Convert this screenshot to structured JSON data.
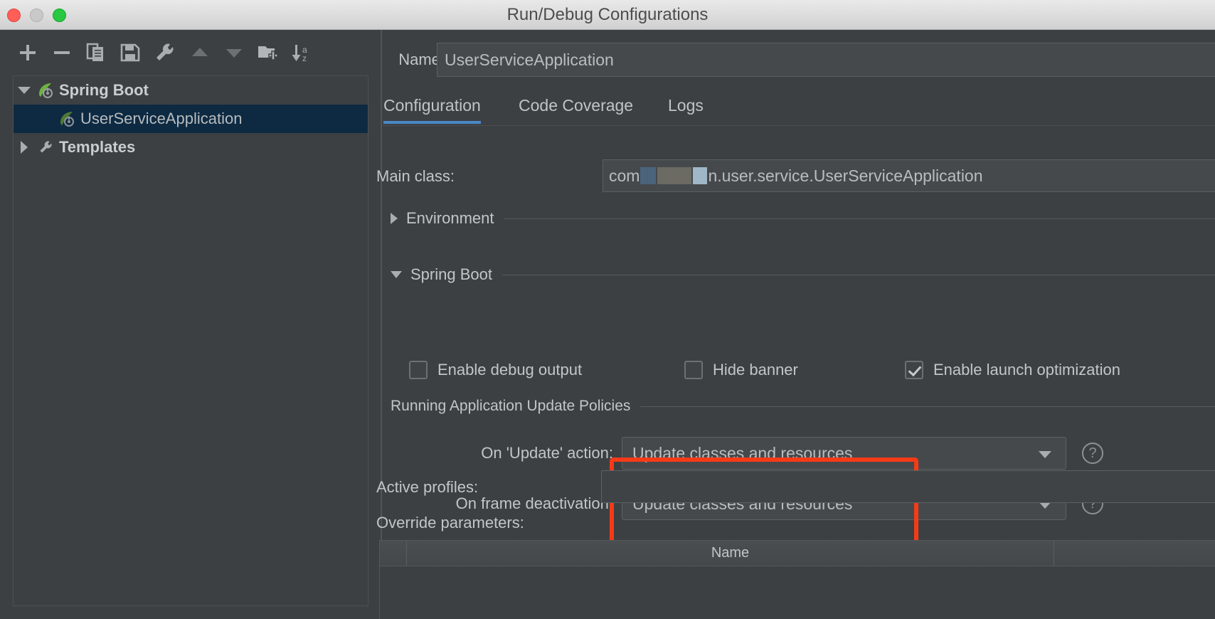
{
  "window": {
    "title": "Run/Debug Configurations",
    "traffic_lights": [
      "close",
      "minimize",
      "maximize"
    ]
  },
  "toolbar": {
    "buttons": [
      {
        "name": "add-button",
        "icon": "plus-icon",
        "label": "Add New Configuration"
      },
      {
        "name": "remove-button",
        "icon": "minus-icon",
        "label": "Remove Configuration"
      },
      {
        "name": "copy-button",
        "icon": "copy-icon",
        "label": "Copy Configuration"
      },
      {
        "name": "save-button",
        "icon": "save-icon",
        "label": "Save Configuration"
      },
      {
        "name": "edit-templates-button",
        "icon": "wrench-icon",
        "label": "Edit Templates"
      },
      {
        "name": "move-up-button",
        "icon": "triangle-up-icon",
        "label": "Move Up"
      },
      {
        "name": "move-down-button",
        "icon": "triangle-down-icon",
        "label": "Move Down"
      },
      {
        "name": "new-folder-button",
        "icon": "folder-add-icon",
        "label": "Create New Folder"
      },
      {
        "name": "sort-button",
        "icon": "sort-az-icon",
        "label": "Sort Configurations"
      }
    ]
  },
  "tree": {
    "nodes": [
      {
        "label": "Spring Boot",
        "level": 0,
        "expanded": true,
        "icon": "spring-boot-icon",
        "selected": false,
        "bold": true
      },
      {
        "label": "UserServiceApplication",
        "level": 1,
        "expanded": null,
        "icon": "spring-boot-icon",
        "selected": true,
        "bold": false
      },
      {
        "label": "Templates",
        "level": 0,
        "expanded": false,
        "icon": "wrench-icon",
        "selected": false,
        "bold": true
      }
    ]
  },
  "form": {
    "name_label": "Name:",
    "name_value": "UserServiceApplication",
    "main_class_label": "Main class:",
    "main_class_prefix": "com",
    "main_class_suffix": "n.user.service.UserServiceApplication",
    "active_profiles_label": "Active profiles:",
    "active_profiles_value": "",
    "override_parameters_label": "Override parameters:"
  },
  "tabs": [
    {
      "label": "Configuration",
      "active": true
    },
    {
      "label": "Code Coverage",
      "active": false
    },
    {
      "label": "Logs",
      "active": false
    }
  ],
  "sections": [
    {
      "title": "Environment",
      "expanded": false
    },
    {
      "title": "Spring Boot",
      "expanded": true
    }
  ],
  "checkboxes": [
    {
      "label": "Enable debug output",
      "checked": false
    },
    {
      "label": "Hide banner",
      "checked": false
    },
    {
      "label": "Enable launch optimization",
      "checked": true
    }
  ],
  "update_policies": {
    "group_title": "Running Application Update Policies",
    "rows": [
      {
        "label": "On 'Update' action:",
        "value": "Update classes and resources",
        "help": "?"
      },
      {
        "label": "On frame deactivation:",
        "value": "Update classes and resources",
        "help": "?"
      }
    ]
  },
  "override_table": {
    "columns": [
      "",
      "Name",
      ""
    ],
    "rows": []
  },
  "annotation": {
    "highlight_color": "#f63a16",
    "shape": "rectangle"
  },
  "colors": {
    "accent_tab": "#4a88c7",
    "selection": "#0d2a42",
    "panel_bg": "#3c4043",
    "field_bg": "#45494c",
    "text": "#c3c6c9"
  }
}
